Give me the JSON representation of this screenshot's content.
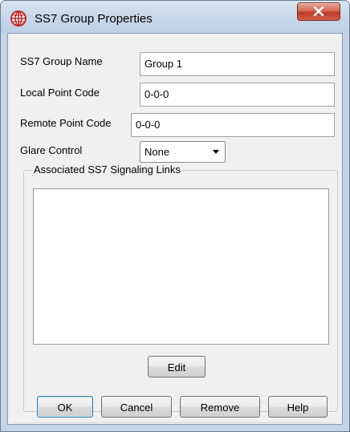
{
  "window": {
    "title": "SS7 Group Properties",
    "close_label": "X",
    "icon": "ss7-globe-icon"
  },
  "form": {
    "group_name": {
      "label": "SS7 Group Name",
      "value": "Group 1"
    },
    "local_point_code": {
      "label": "Local Point Code",
      "value": "0-0-0"
    },
    "remote_point_code": {
      "label": "Remote Point Code",
      "value": "0-0-0"
    },
    "glare_control": {
      "label": "Glare Control",
      "selected": "None"
    }
  },
  "links_group": {
    "legend": "Associated SS7 Signaling Links",
    "items": [],
    "edit_label": "Edit"
  },
  "buttons": {
    "ok": "OK",
    "cancel": "Cancel",
    "remove": "Remove",
    "help": "Help"
  },
  "colors": {
    "accent_icon": "#c0282d",
    "close_button": "#c0392b",
    "client_background": "#f0f0f0"
  }
}
